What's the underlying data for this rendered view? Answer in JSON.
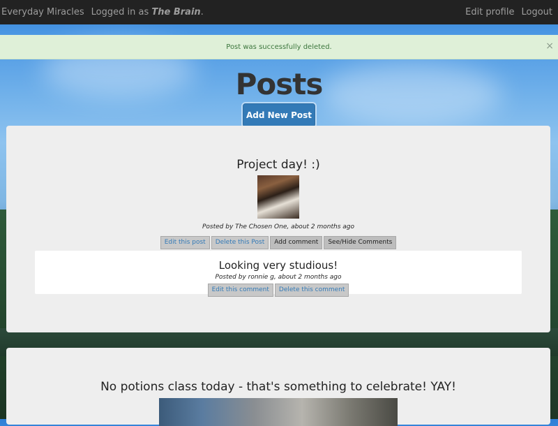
{
  "navbar": {
    "brand": "Everyday Miracles",
    "logged_in_prefix": "Logged in as",
    "username": "The Brain",
    "logged_in_suffix": ".",
    "links": [
      "Edit profile",
      "Logout"
    ]
  },
  "alert": {
    "message": "Post was successfully deleted.",
    "close_label": "×"
  },
  "page": {
    "title": "Posts",
    "add_button_label": "Add New Post"
  },
  "posts": [
    {
      "title": "Project day! :)",
      "image_desc": "students-studying-thumbnail",
      "meta": "Posted by The Chosen One, about 2 months ago",
      "actions": [
        "Edit this post",
        "Delete this Post",
        "Add comment",
        "See/Hide Comments"
      ],
      "comments": [
        {
          "text": "Looking very studious!",
          "meta": "Posted by ronnie g, about 2 months ago",
          "actions": [
            "Edit this comment",
            "Delete this comment"
          ]
        }
      ]
    },
    {
      "title": "No potions class today - that's something to celebrate! YAY!",
      "image_desc": "castle-window-image"
    }
  ],
  "colors": {
    "navbar_bg": "#222222",
    "alert_bg": "#dff0d8",
    "primary_button": "#337ab7",
    "card_bg": "#eeeeee"
  }
}
